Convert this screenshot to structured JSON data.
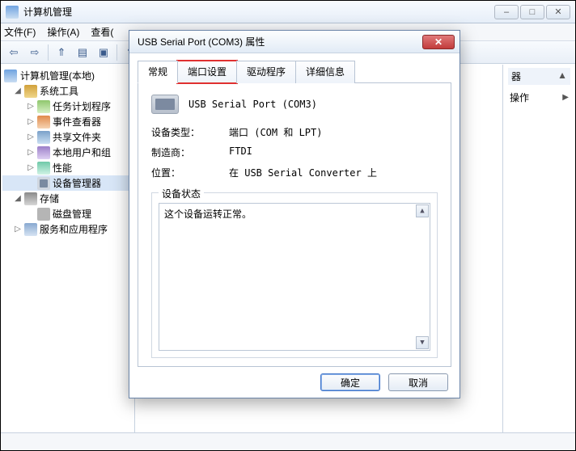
{
  "window": {
    "title": "计算机管理",
    "menu": {
      "file": "文件(F)",
      "action": "操作(A)",
      "view_truncated": "查看("
    }
  },
  "tree": {
    "root": "计算机管理(本地)",
    "system_tools": "系统工具",
    "task_scheduler": "任务计划程序",
    "event_viewer": "事件查看器",
    "shared_folders": "共享文件夹",
    "local_users": "本地用户和组",
    "performance": "性能",
    "device_manager": "设备管理器",
    "storage": "存储",
    "disk_mgmt": "磁盘管理",
    "services": "服务和应用程序"
  },
  "right_pane": {
    "item_device_suffix": "器",
    "actions_label": "操作"
  },
  "dialog": {
    "title": "USB Serial Port (COM3) 属性",
    "tabs": {
      "general": "常规",
      "port": "端口设置",
      "driver": "驱动程序",
      "details": "详细信息"
    },
    "device_name": "USB Serial Port (COM3)",
    "rows": {
      "type_label": "设备类型：",
      "type_value": "端口 (COM 和 LPT)",
      "mfg_label": "制造商：",
      "mfg_value": "FTDI",
      "loc_label": "位置：",
      "loc_value": "在 USB Serial Converter 上"
    },
    "status_group": "设备状态",
    "status_text": "这个设备运转正常。",
    "ok": "确定",
    "cancel": "取消"
  }
}
